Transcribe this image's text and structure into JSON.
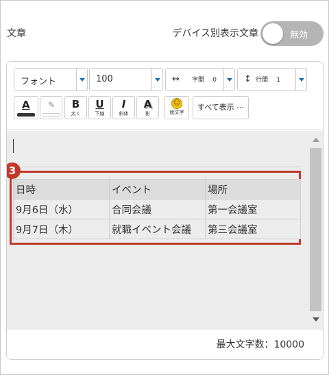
{
  "header": {
    "left_label": "文章",
    "device_label": "デバイス別表示文章",
    "toggle_label": "無効"
  },
  "toolbar": {
    "font_select": "フォント",
    "size_select": "100",
    "letter_spacing_label": "字間",
    "letter_spacing_value": "0",
    "line_spacing_label": "行間",
    "line_spacing_value": "1",
    "bold": {
      "glyph": "B",
      "label": "太く"
    },
    "underline": {
      "glyph": "U",
      "label": "下線"
    },
    "italic": {
      "glyph": "I",
      "label": "斜体"
    },
    "shadow": {
      "glyph": "A",
      "label": "影"
    },
    "emoji": {
      "label": "絵文字"
    },
    "show_all": "すべて表示 ⋯",
    "text_color_glyph": "A",
    "text_color": "#333333",
    "highlight_color": "#ffffff"
  },
  "callout": {
    "number": "3",
    "color": "#c0392b"
  },
  "table": {
    "headers": [
      "日時",
      "イベント",
      "場所"
    ],
    "rows": [
      [
        "9月6日（水）",
        "合同会議",
        "第一会議室"
      ],
      [
        "9月7日（木）",
        "就職イベント会議",
        "第三会議室"
      ]
    ]
  },
  "footer": {
    "char_limit": "最大文字数：10000"
  }
}
